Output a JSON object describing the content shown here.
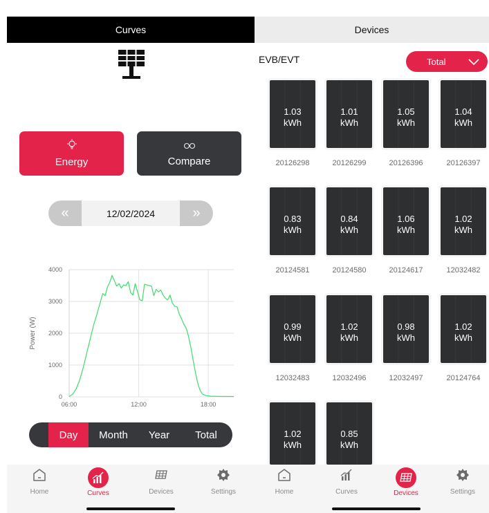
{
  "left": {
    "header_title": "Curves",
    "energy_label": "Energy",
    "compare_label": "Compare",
    "date": "12/02/2024",
    "prev_glyph": "«",
    "next_glyph": "»",
    "periods": [
      {
        "label": "Day",
        "active": true
      },
      {
        "label": "Month",
        "active": false
      },
      {
        "label": "Year",
        "active": false
      },
      {
        "label": "Total",
        "active": false
      }
    ],
    "tabs": [
      {
        "label": "Home",
        "icon": "home-icon",
        "active": false
      },
      {
        "label": "Curves",
        "icon": "curves-icon",
        "active": true
      },
      {
        "label": "Devices",
        "icon": "devices-icon",
        "active": false
      },
      {
        "label": "Settings",
        "icon": "gear-icon",
        "active": false
      }
    ]
  },
  "right": {
    "header_title": "Devices",
    "group_label": "EVB/EVT",
    "select_value": "Total",
    "devices": [
      {
        "value": "1.03",
        "unit": "kWh",
        "serial": "20126298"
      },
      {
        "value": "1.01",
        "unit": "kWh",
        "serial": "20126299"
      },
      {
        "value": "1.05",
        "unit": "kWh",
        "serial": "20126396"
      },
      {
        "value": "1.04",
        "unit": "kWh",
        "serial": "20126397"
      },
      {
        "value": "0.83",
        "unit": "kWh",
        "serial": "20124581"
      },
      {
        "value": "0.84",
        "unit": "kWh",
        "serial": "20124580"
      },
      {
        "value": "1.06",
        "unit": "kWh",
        "serial": "20124617"
      },
      {
        "value": "1.02",
        "unit": "kWh",
        "serial": "12032482"
      },
      {
        "value": "0.99",
        "unit": "kWh",
        "serial": "12032483"
      },
      {
        "value": "1.02",
        "unit": "kWh",
        "serial": "12032496"
      },
      {
        "value": "0.98",
        "unit": "kWh",
        "serial": "12032497"
      },
      {
        "value": "1.02",
        "unit": "kWh",
        "serial": "20124764"
      },
      {
        "value": "1.02",
        "unit": "kWh",
        "serial": ""
      },
      {
        "value": "0.85",
        "unit": "kWh",
        "serial": ""
      }
    ],
    "tabs": [
      {
        "label": "Home",
        "icon": "home-icon",
        "active": false
      },
      {
        "label": "Curves",
        "icon": "curves-icon",
        "active": false
      },
      {
        "label": "Devices",
        "icon": "devices-icon",
        "active": true
      },
      {
        "label": "Settings",
        "icon": "gear-icon",
        "active": false
      }
    ]
  },
  "colors": {
    "accent": "#e4234a",
    "dark": "#36383b",
    "line": "#3ddc6b"
  },
  "chart_data": {
    "type": "line",
    "title": "",
    "xlabel": "",
    "ylabel": "Power (W)",
    "ylim": [
      0,
      4000
    ],
    "yticks": [
      0,
      1000,
      2000,
      3000,
      4000
    ],
    "xticks": [
      "06:00",
      "12:00",
      "18:00"
    ],
    "xlim_hours": [
      6,
      20.2
    ],
    "grid": true,
    "series": [
      {
        "values": [
          [
            6.0,
            10
          ],
          [
            6.3,
            80
          ],
          [
            6.6,
            250
          ],
          [
            6.9,
            520
          ],
          [
            7.2,
            900
          ],
          [
            7.5,
            1350
          ],
          [
            7.8,
            1800
          ],
          [
            8.1,
            2250
          ],
          [
            8.4,
            2600
          ],
          [
            8.7,
            3000
          ],
          [
            8.9,
            3250
          ],
          [
            9.1,
            3180
          ],
          [
            9.3,
            3450
          ],
          [
            9.5,
            3600
          ],
          [
            9.7,
            3820
          ],
          [
            9.9,
            3650
          ],
          [
            10.1,
            3480
          ],
          [
            10.3,
            3560
          ],
          [
            10.5,
            3420
          ],
          [
            10.7,
            3520
          ],
          [
            10.9,
            3500
          ],
          [
            11.1,
            3620
          ],
          [
            11.3,
            3280
          ],
          [
            11.5,
            3200
          ],
          [
            11.7,
            3560
          ],
          [
            11.9,
            3300
          ],
          [
            12.1,
            3050
          ],
          [
            12.3,
            3020
          ],
          [
            12.5,
            3540
          ],
          [
            12.7,
            3520
          ],
          [
            12.9,
            3500
          ],
          [
            13.1,
            3480
          ],
          [
            13.3,
            3180
          ],
          [
            13.5,
            3380
          ],
          [
            13.7,
            3300
          ],
          [
            13.9,
            3360
          ],
          [
            14.1,
            3200
          ],
          [
            14.3,
            3100
          ],
          [
            14.5,
            3050
          ],
          [
            14.7,
            3200
          ],
          [
            14.9,
            2950
          ],
          [
            15.1,
            2850
          ],
          [
            15.3,
            2830
          ],
          [
            15.5,
            2600
          ],
          [
            15.7,
            2450
          ],
          [
            15.9,
            2280
          ],
          [
            16.1,
            2150
          ],
          [
            16.3,
            1900
          ],
          [
            16.5,
            1550
          ],
          [
            16.7,
            1150
          ],
          [
            16.9,
            750
          ],
          [
            17.1,
            420
          ],
          [
            17.3,
            200
          ],
          [
            17.5,
            90
          ],
          [
            17.8,
            40
          ],
          [
            18.2,
            20
          ],
          [
            19.0,
            15
          ],
          [
            20.2,
            10
          ]
        ]
      }
    ]
  }
}
